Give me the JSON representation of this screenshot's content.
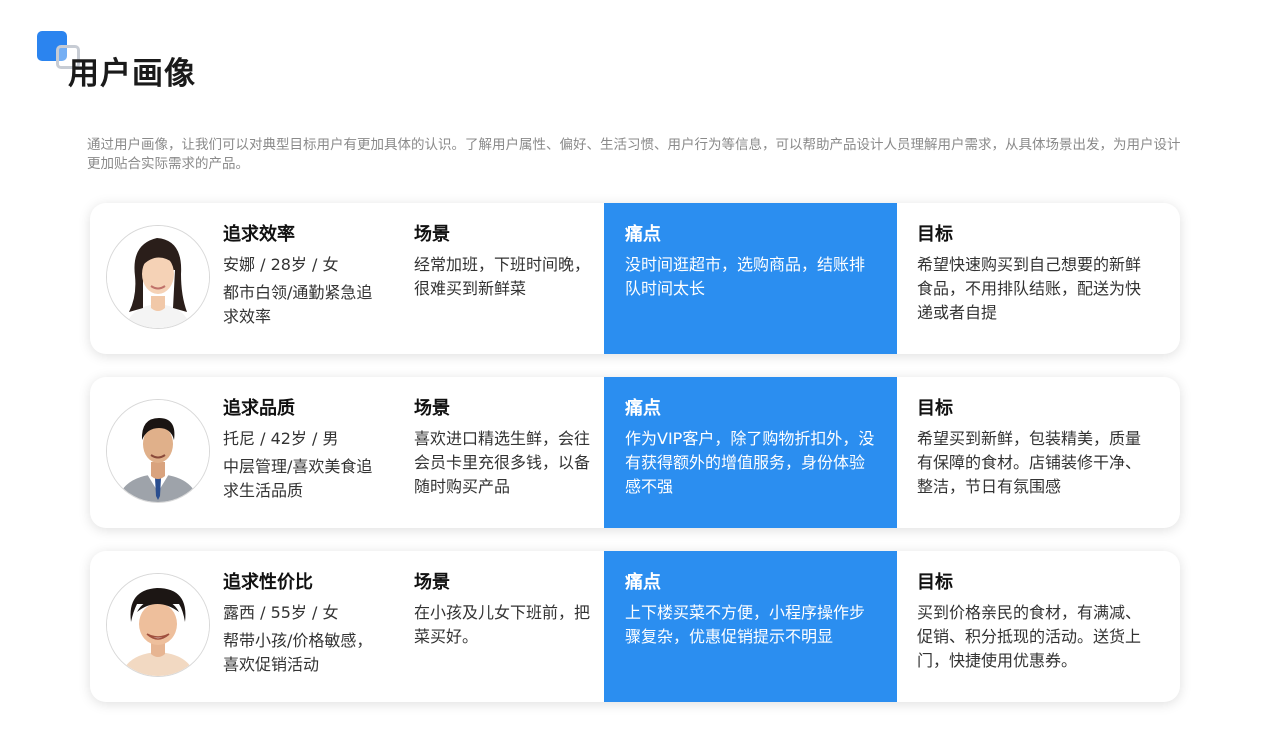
{
  "page": {
    "title": "用户画像",
    "intro": "通过用户画像，让我们可以对典型目标用户有更加具体的认识。了解用户属性、偏好、生活习惯、用户行为等信息，可以帮助产品设计人员理解用户需求，从具体场景出发，为用户设计更加贴合实际需求的产品。"
  },
  "colors": {
    "accent": "#2b8ef0",
    "logo_primary": "#2b84ef",
    "logo_secondary": "#c7ccd4"
  },
  "personas": [
    {
      "heading": "追求效率",
      "info": "安娜 / 28岁 / 女",
      "desc": "都市白领/通勤紧急追求效率",
      "scene_label": "场景",
      "scene": "经常加班，下班时间晚，很难买到新鲜菜",
      "pain_label": "痛点",
      "pain": "没时间逛超市，选购商品，结账排队时间太长",
      "goal_label": "目标",
      "goal": "希望快速购买到自己想要的新鲜食品，不用排队结账，配送为快递或者自提"
    },
    {
      "heading": "追求品质",
      "info": "托尼 / 42岁 / 男",
      "desc": "中层管理/喜欢美食追求生活品质",
      "scene_label": "场景",
      "scene": "喜欢进口精选生鲜，会往会员卡里充很多钱，以备随时购买产品",
      "pain_label": "痛点",
      "pain": "作为VIP客户，除了购物折扣外，没有获得额外的增值服务，身份体验感不强",
      "goal_label": "目标",
      "goal": "希望买到新鲜，包装精美，质量有保障的食材。店铺装修干净、整洁，节日有氛围感"
    },
    {
      "heading": "追求性价比",
      "info": "露西 / 55岁 / 女",
      "desc": "帮带小孩/价格敏感，喜欢促销活动",
      "scene_label": "场景",
      "scene": "在小孩及儿女下班前，把菜买好。",
      "pain_label": "痛点",
      "pain": "上下楼买菜不方便，小程序操作步骤复杂，优惠促销提示不明显",
      "goal_label": "目标",
      "goal": "买到价格亲民的食材，有满减、促销、积分抵现的活动。送货上门，快捷使用优惠券。"
    }
  ]
}
